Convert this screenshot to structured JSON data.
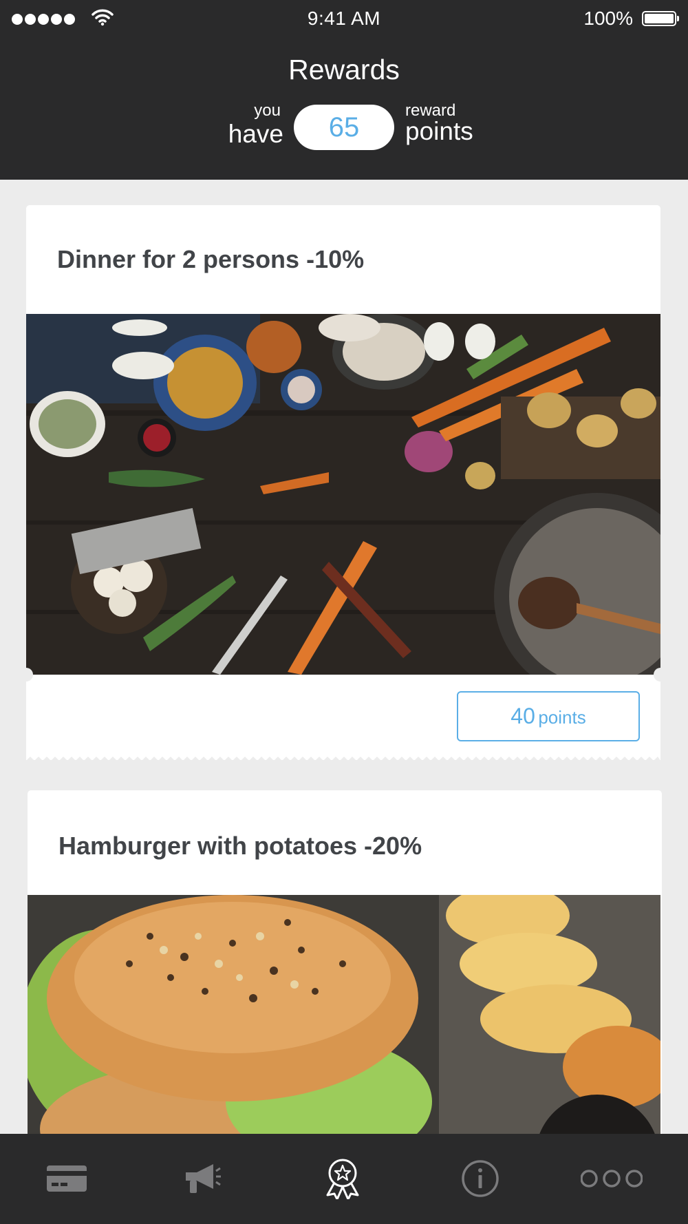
{
  "status_bar": {
    "time": "9:41 AM",
    "battery": "100%"
  },
  "header": {
    "title": "Rewards",
    "you_label": "you",
    "have_label": "have",
    "points_value": "65",
    "reward_label": "reward",
    "points_label": "points"
  },
  "rewards": [
    {
      "title": "Dinner for 2 persons -10%",
      "cost_number": "40",
      "cost_unit": "points"
    },
    {
      "title": "Hamburger with potatoes -20%"
    }
  ],
  "tabbar": {
    "tabs": [
      {
        "icon": "card-icon",
        "active": false
      },
      {
        "icon": "megaphone-icon",
        "active": false
      },
      {
        "icon": "award-icon",
        "active": true
      },
      {
        "icon": "info-icon",
        "active": false
      },
      {
        "icon": "more-icon",
        "active": false
      }
    ]
  },
  "colors": {
    "header": "#2a2a2b",
    "accent": "#5aaee6",
    "background": "#ececec",
    "title_text": "#414448"
  }
}
